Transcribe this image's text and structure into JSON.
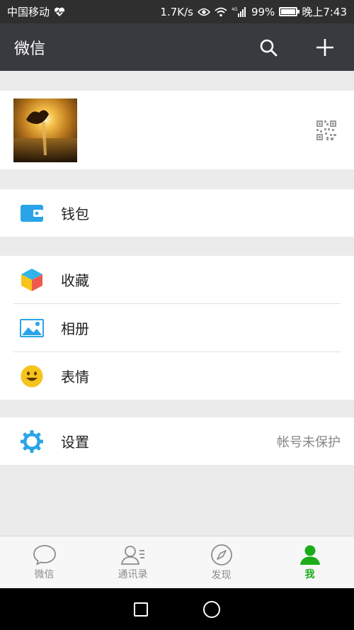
{
  "status_bar": {
    "carrier": "中国移动",
    "speed": "1.7K/s",
    "network": "4G",
    "battery_percent": "99%",
    "battery_level": 0.99,
    "time": "晚上7:43"
  },
  "header": {
    "title": "微信"
  },
  "profile": {
    "avatar_icon": "sunset-hand-avatar",
    "qr_icon": "qr-code-icon"
  },
  "menu": {
    "wallet": {
      "label": "钱包",
      "icon": "wallet-icon"
    },
    "favorites": {
      "label": "收藏",
      "icon": "cube-icon"
    },
    "album": {
      "label": "相册",
      "icon": "picture-icon"
    },
    "stickers": {
      "label": "表情",
      "icon": "smiley-icon"
    },
    "settings": {
      "label": "设置",
      "hint": "帐号未保护",
      "icon": "gear-icon"
    }
  },
  "tabs": [
    {
      "label": "微信",
      "icon": "chat-bubble-icon",
      "active": false
    },
    {
      "label": "通讯录",
      "icon": "contacts-icon",
      "active": false
    },
    {
      "label": "发现",
      "icon": "compass-icon",
      "active": false
    },
    {
      "label": "我",
      "icon": "person-icon",
      "active": true
    }
  ],
  "colors": {
    "header_bg": "#393a3f",
    "status_bg": "#2f2f2f",
    "active_tab": "#1aad19",
    "inactive_tab": "#8c8c8c",
    "wallet_blue": "#2aa4e8",
    "gear_blue": "#2aa4e8",
    "smiley_yellow": "#f5c31b"
  }
}
